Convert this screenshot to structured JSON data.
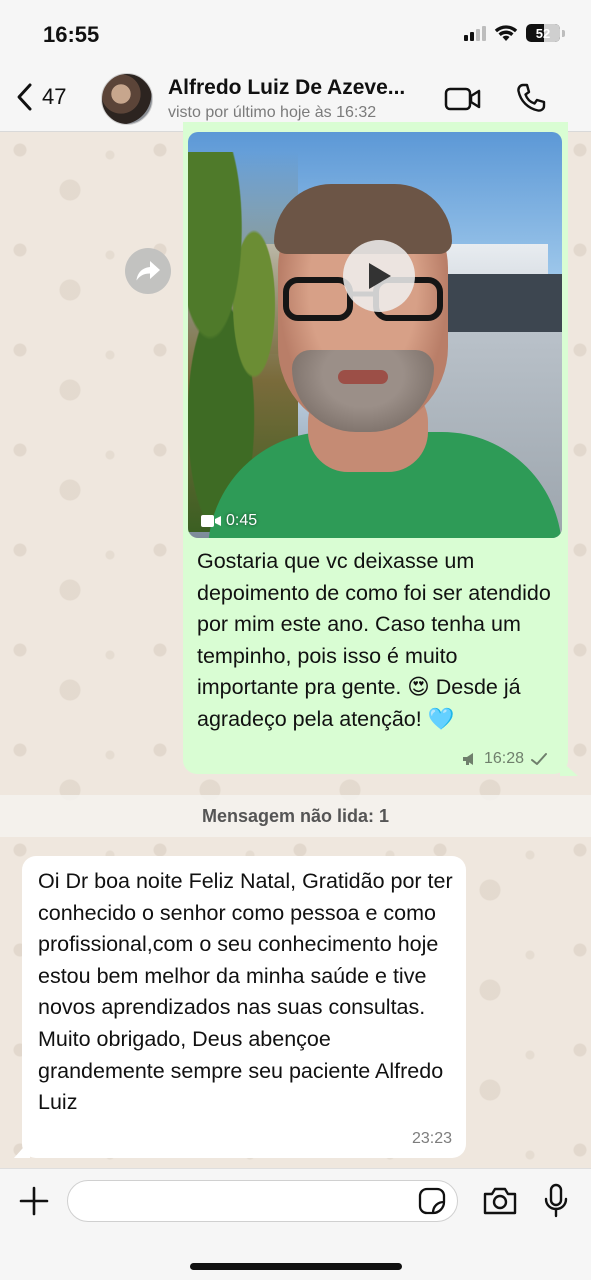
{
  "status_bar": {
    "time": "16:55",
    "battery": "52"
  },
  "header": {
    "back_count": "47",
    "contact_name": "Alfredo Luiz De Azeve...",
    "last_seen": "visto por último hoje às 16:32"
  },
  "messages": {
    "outgoing": {
      "video_duration": "0:45",
      "text": "Gostaria que vc deixasse um depoimento de como foi ser atendido por mim este ano. Caso tenha um tempinho, pois isso é muito importante pra gente. 😍 Desde já agradeço pela atenção! 🩵",
      "time": "16:28"
    },
    "unread_divider": "Mensagem não lida: 1",
    "incoming": {
      "text": "Oi Dr boa noite Feliz Natal, Gratidão por ter conhecido o senhor como pessoa e como profissional,com o seu conhecimento hoje estou bem melhor da minha saúde e tive novos aprendizados nas suas consultas. Muito obrigado, Deus abençoe grandemente sempre seu paciente Alfredo Luiz",
      "time": "23:23"
    }
  },
  "input": {
    "placeholder": ""
  },
  "icons": {
    "back": "chevron-left-icon",
    "video_call": "video-camera-icon",
    "voice_call": "phone-icon",
    "forward": "forward-arrow-icon",
    "play": "play-icon",
    "plus": "plus-icon",
    "sticker": "sticker-icon",
    "camera": "camera-icon",
    "mic": "microphone-icon"
  },
  "colors": {
    "outgoing_bubble": "#d9fdd3",
    "incoming_bubble": "#ffffff",
    "wallpaper": "#efe7de",
    "header": "#f6f6f6"
  }
}
